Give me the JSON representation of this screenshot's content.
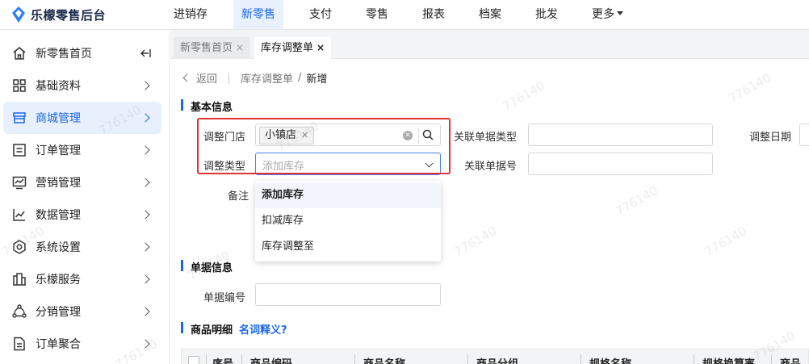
{
  "app": {
    "logo_text": "乐檬零售后台"
  },
  "nav": {
    "items": [
      {
        "label": "进销存"
      },
      {
        "label": "新零售"
      },
      {
        "label": "支付"
      },
      {
        "label": "零售"
      },
      {
        "label": "报表"
      },
      {
        "label": "档案"
      },
      {
        "label": "批发"
      },
      {
        "label": "更多"
      }
    ],
    "active_index": 1
  },
  "sidebar": {
    "items": [
      {
        "label": "新零售首页",
        "icon": "home-icon"
      },
      {
        "label": "基础资料",
        "icon": "grid-icon"
      },
      {
        "label": "商城管理",
        "icon": "shop-icon"
      },
      {
        "label": "订单管理",
        "icon": "list-icon"
      },
      {
        "label": "营销管理",
        "icon": "monitor-chart-icon"
      },
      {
        "label": "数据管理",
        "icon": "line-chart-icon"
      },
      {
        "label": "系统设置",
        "icon": "settings-icon"
      },
      {
        "label": "乐檬服务",
        "icon": "building-icon"
      },
      {
        "label": "分销管理",
        "icon": "share-icon"
      },
      {
        "label": "订单聚合",
        "icon": "document-icon"
      }
    ],
    "active_index": 2
  },
  "tabs": [
    {
      "label": "新零售首页",
      "close": "×"
    },
    {
      "label": "库存调整单",
      "close": "×"
    }
  ],
  "breadcrumb": {
    "back": "返回",
    "parent": "库存调整单",
    "separator": "/",
    "current": "新增"
  },
  "sections": {
    "basic": "基本信息",
    "document": "单据信息",
    "products": "商品明细",
    "glossary_link": "名词释义?"
  },
  "form": {
    "store_label": "调整门店",
    "store_tag": "小镇店",
    "type_label": "调整类型",
    "type_placeholder": "添加库存",
    "related_type_label": "关联单据类型",
    "adjust_date_label": "调整日期",
    "related_no_label": "关联单据号",
    "remark_label": "备注",
    "doc_no_label": "单据编号"
  },
  "dropdown": {
    "options": [
      "添加库存",
      "扣减库存",
      "库存调整至"
    ],
    "highlighted_index": 0
  },
  "table": {
    "columns": [
      "序号",
      "商品编码",
      "商品名称",
      "商品分组",
      "规格名称",
      "规格换算率",
      "商品"
    ]
  },
  "watermark": "776140",
  "colors": {
    "accent": "#1a66e8",
    "highlight_box": "#e03232",
    "active_bg": "#e8effd"
  }
}
